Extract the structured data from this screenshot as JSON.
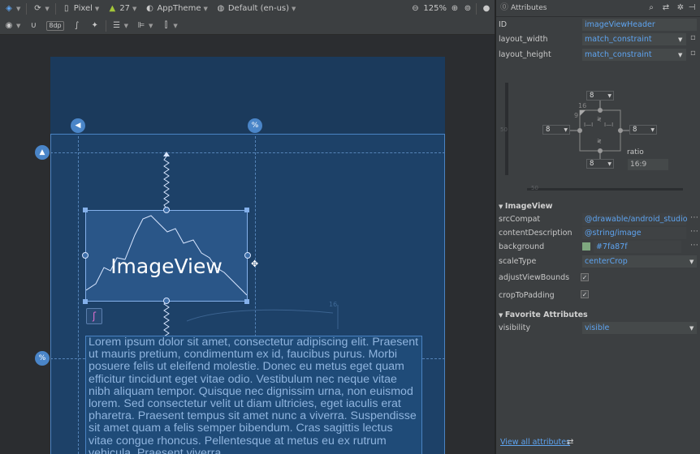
{
  "toolbar": {
    "device": "Pixel",
    "api_level": "27",
    "theme": "AppTheme",
    "locale": "Default (en-us)",
    "zoom": "125%",
    "dp_badge": "8dp"
  },
  "canvas": {
    "image_view_label": "ImageView",
    "guide_percent": "%",
    "margin_hint": "16",
    "lorem": "Lorem ipsum dolor sit amet, consectetur adipiscing elit. Praesent ut mauris pretium, condimentum ex id, faucibus purus. Morbi posuere felis ut eleifend molestie. Donec eu metus eget quam efficitur tincidunt eget vitae odio. Vestibulum nec neque vitae nibh aliquam tempor. Quisque nec dignissim urna, non euismod lorem. Sed consectetur velit ut diam ultricies, eget iaculis erat pharetra. Praesent tempus sit amet nunc a viverra. Suspendisse sit amet quam a felis semper bibendum. Cras sagittis lectus vitae congue rhoncus. Pellentesque at metus eu ex rutrum vehicula. Praesent viverra"
  },
  "panel": {
    "title": "Attributes",
    "id_label": "ID",
    "id_value": "imageViewHeader",
    "layout_width_label": "layout_width",
    "layout_width_value": "match_constraint",
    "layout_height_label": "layout_height",
    "layout_height_value": "match_constraint",
    "constraint": {
      "top": "8",
      "left": "8",
      "right": "8",
      "bottom": "8",
      "bias_small": "16",
      "bias_nine": "9",
      "slider_v": "50",
      "slider_h": "50",
      "ratio_label": "ratio",
      "ratio_value": "16:9"
    },
    "imageview_section": "ImageView",
    "src_label": "srcCompat",
    "src_value": "@drawable/android_studio",
    "content_label": "contentDescription",
    "content_value": "@string/image",
    "background_label": "background",
    "background_value": "#7fa87f",
    "background_color": "#7fa87f",
    "scale_label": "scaleType",
    "scale_value": "centerCrop",
    "adjust_label": "adjustViewBounds",
    "crop_label": "cropToPadding",
    "favorites_section": "Favorite Attributes",
    "visibility_label": "visibility",
    "visibility_value": "visible",
    "view_all": "View all attributes"
  }
}
